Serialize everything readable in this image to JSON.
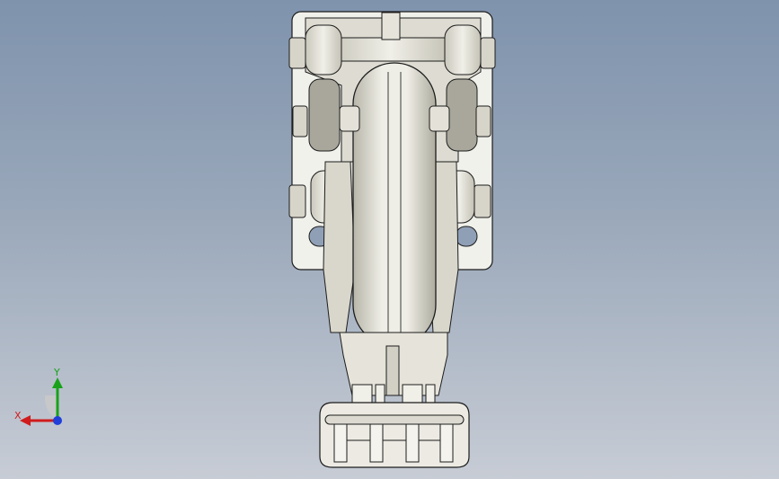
{
  "axes": {
    "x": "X",
    "y": "Y"
  },
  "colors": {
    "background_top": "#7f93ad",
    "background_bottom": "#c7ccd5",
    "part_fill": "#e9e8df",
    "part_shade": "#cfcdc2",
    "outline": "#1c1c1c",
    "axis_x": "#d01c1c",
    "axis_y": "#18a21a",
    "axis_z": "#1f3fd8"
  }
}
